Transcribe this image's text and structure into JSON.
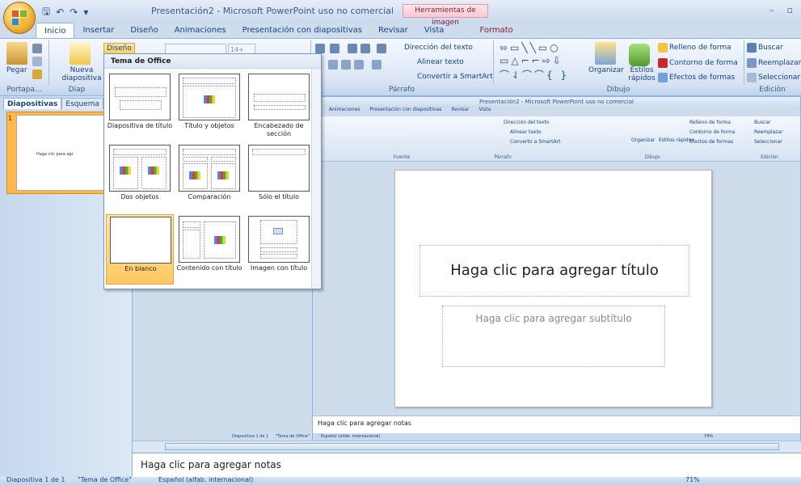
{
  "app": {
    "title": "Presentación2 - Microsoft PowerPoint uso no comercial",
    "contextual_tool_title": "Herramientas de imagen",
    "window_controls": [
      "–",
      "▫"
    ]
  },
  "quick_access": {
    "icons": [
      "save-icon",
      "undo-icon",
      "redo-icon",
      "customize-icon"
    ],
    "glyphs": [
      "🖫",
      "↶",
      "↷",
      "▾"
    ]
  },
  "ribbon_tabs": [
    "Inicio",
    "Insertar",
    "Diseño",
    "Animaciones",
    "Presentación con diapositivas",
    "Revisar",
    "Vista"
  ],
  "contextual_tab": "Formato",
  "ribbon": {
    "clipboard": {
      "paste": "Pegar",
      "group": "Portapa..."
    },
    "slides": {
      "new_slide": "Nueva diapositiva",
      "layout": "Diseño",
      "group": "Diap"
    },
    "paragraph": {
      "text_direction": "Dirección del texto",
      "align_text": "Alinear texto",
      "smartart": "Convertir a SmartArt",
      "group": "Párrafo"
    },
    "drawing": {
      "arrange": "Organizar",
      "quick_styles": "Estilos rápidos",
      "shape_fill": "Relleno de forma",
      "shape_outline": "Contorno de forma",
      "shape_effects": "Efectos de formas",
      "group": "Dibujo",
      "shapes_row1": "⬄▭╲╲▭○",
      "shapes_row2": "▭△⌐⌐⇨⇩",
      "shapes_row3": "⌒⇃⌒⌒{ }"
    },
    "editing": {
      "find": "Buscar",
      "replace": "Reemplazar",
      "select": "Seleccionar",
      "group": "Edición"
    },
    "font_size_value": "14+"
  },
  "layout_gallery": {
    "heading": "Tema de Office",
    "selected": "En blanco",
    "layouts": [
      "Diapositiva de título",
      "Título y objetos",
      "Encabezado de sección",
      "Dos objetos",
      "Comparación",
      "Sólo el título",
      "En blanco",
      "Contenido con título",
      "Imagen con título"
    ]
  },
  "panel": {
    "tabs": [
      "Diapositivas",
      "Esquema"
    ],
    "close": "✕",
    "slide_number": "1",
    "thumb_text": "Haga clic para agr"
  },
  "inner_window": {
    "title": "Presentación2 - Microsoft PowerPoint uso no comercial",
    "tabs": [
      "Animaciones",
      "Presentación con diapositivas",
      "Revisar",
      "Vista"
    ],
    "groups": [
      "Fuente",
      "Párrafo",
      "Dibujo",
      "Edición"
    ],
    "ribbon_items": [
      "Dirección del texto",
      "Alinear texto",
      "Convertir a SmartArt",
      "Organizar",
      "Estilos rápidos",
      "Relleno de forma",
      "Contorno de forma",
      "Efectos de formas",
      "Buscar",
      "Reemplazar",
      "Seleccionar"
    ],
    "slide_title_placeholder": "Haga clic para agregar título",
    "slide_subtitle_placeholder": "Haga clic para agregar subtítulo",
    "notes_placeholder": "Haga clic para agregar notas",
    "status_slide": "Diapositiva 1 de 1",
    "status_theme": "\"Tema de Office\"",
    "status_lang": "Español (alfab. internacional)",
    "zoom": "74%"
  },
  "notes_placeholder": "Haga clic para agregar notas",
  "status_bar": {
    "slide": "Diapositiva 1 de 1",
    "theme": "\"Tema de Office\"",
    "language": "Español (alfab. internacional)",
    "zoom": "71%"
  }
}
